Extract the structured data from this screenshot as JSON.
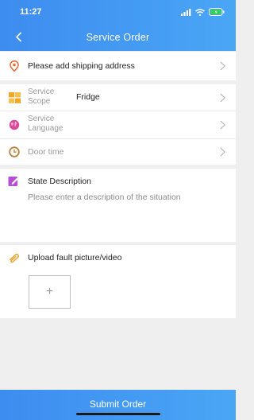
{
  "status_bar": {
    "time": "11:27"
  },
  "header": {
    "title": "Service Order"
  },
  "address_row": {
    "label": "Please add shipping address"
  },
  "service_scope": {
    "label_line1": "Service",
    "label_line2": "Scope",
    "value": "Fridge"
  },
  "service_language": {
    "label_line1": "Service",
    "label_line2": "Language"
  },
  "door_time": {
    "label": "Door time"
  },
  "state_description": {
    "title": "State Description",
    "placeholder": "Please enter a description of the situation"
  },
  "upload": {
    "title": "Upload fault picture/video",
    "add_symbol": "+"
  },
  "submit": {
    "label": "Submit Order"
  },
  "colors": {
    "header": "#3d8cf0",
    "address_icon": "#e2713c",
    "scope_icon": "#f2a623",
    "language_icon": "#d84a9a",
    "time_icon": "#b8823d",
    "desc_icon": "#b64fd2",
    "upload_icon": "#e6a736"
  },
  "icons": [
    "back-icon",
    "location-icon",
    "scope-icon",
    "language-icon",
    "clock-icon",
    "edit-icon",
    "paperclip-icon",
    "chevron-right-icon",
    "signal-icon",
    "wifi-icon",
    "battery-icon"
  ]
}
